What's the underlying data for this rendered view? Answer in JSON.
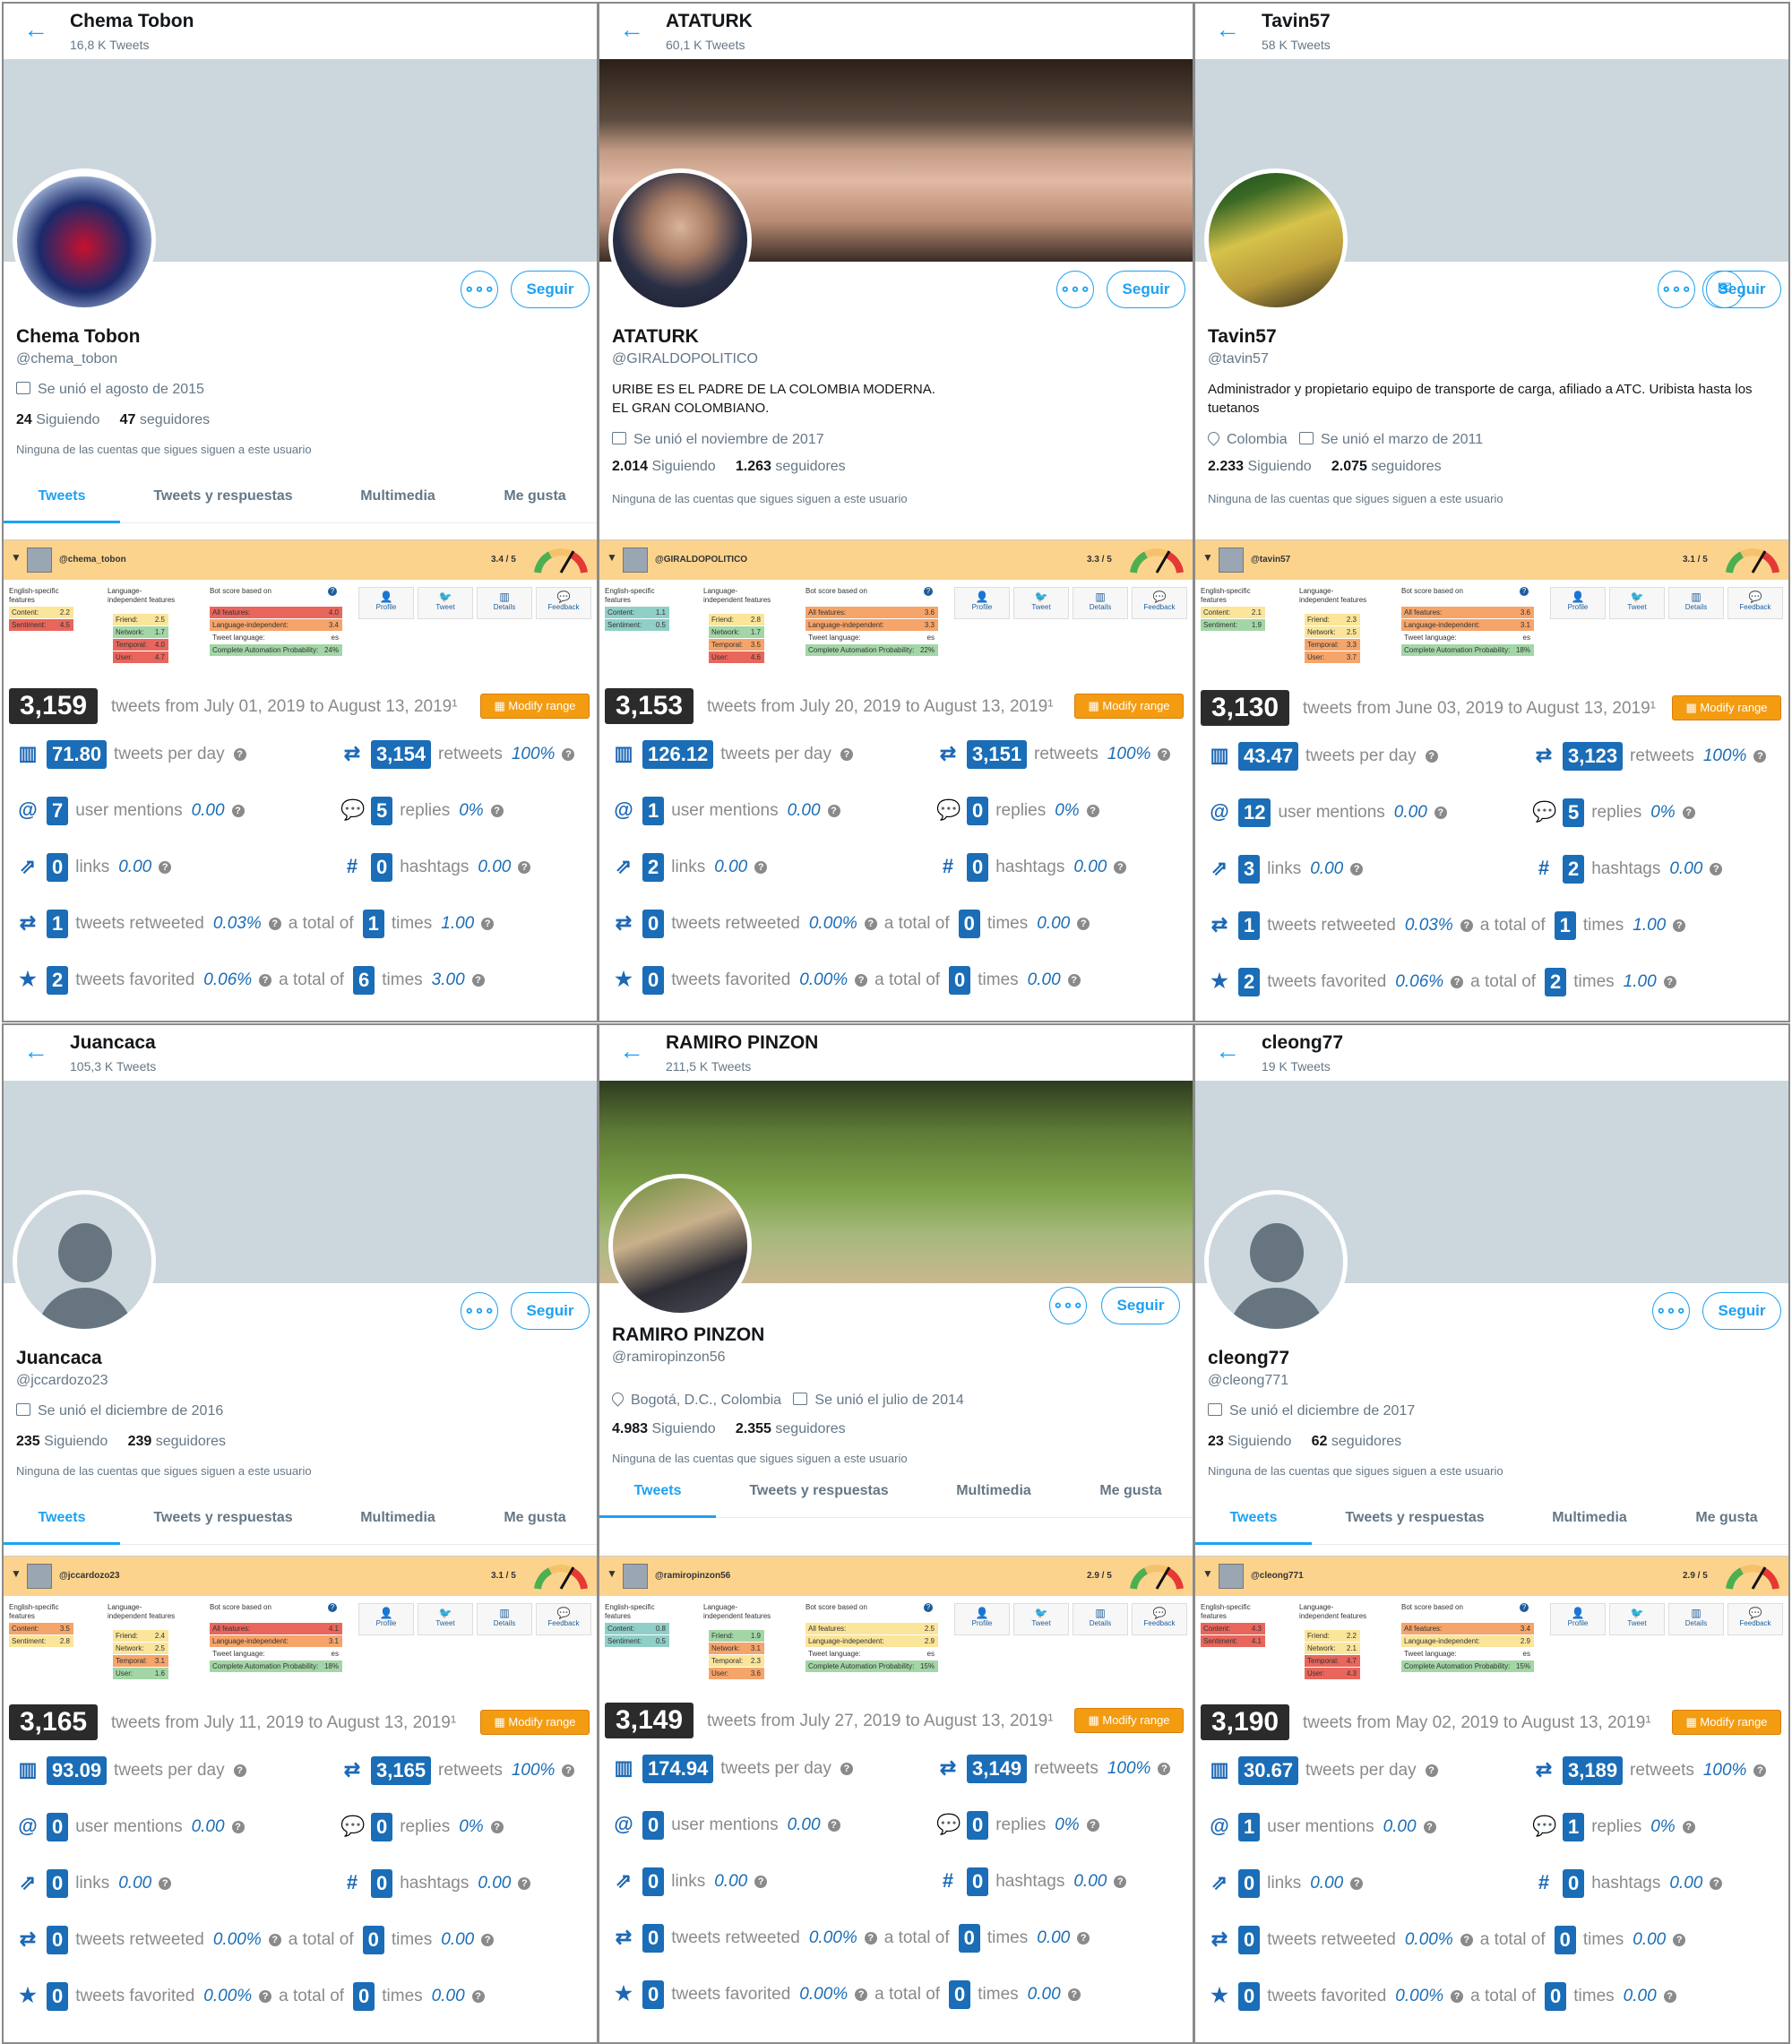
{
  "ui": {
    "back_glyph": "←",
    "more_glyph": "∘∘∘",
    "follow_label": "Seguir",
    "tab_labels": [
      "Tweets",
      "Tweets y respuestas",
      "Multimedia",
      "Me gusta"
    ],
    "modify_label": "Modify range",
    "following_label": "Siguiendo",
    "followers_label": "seguidores",
    "no_follow_text": "Ninguna de las cuentas que sigues siguen a este usuario",
    "lbl_tpd": "tweets per day",
    "lbl_retweets": "retweets",
    "lbl_mentions": "user mentions",
    "lbl_replies": "replies",
    "lbl_links": "links",
    "lbl_hashtags": "hashtags",
    "lbl_rtw": "tweets retweeted",
    "lbl_fav": "tweets favorited",
    "lbl_total": "a total of",
    "lbl_times": "times",
    "b_english": "English-specific features",
    "b_lang": "Language-independent features",
    "b_score": "Bot score based on",
    "b_content": "Content:",
    "b_sentiment": "Sentiment:",
    "b_friend": "Friend:",
    "b_network": "Network:",
    "b_temporal": "Temporal:",
    "b_user": "User:",
    "b_all": "All features:",
    "b_langind": "Language-independent:",
    "b_tl": "Tweet language:",
    "b_cap": "Complete Automation Probability:",
    "b_profile": "Profile",
    "b_tweet": "Tweet",
    "b_details": "Details",
    "b_feedback": "Feedback",
    "icon_names": [
      "chart-icon",
      "retweet-icon",
      "mention-icon",
      "replies-icon",
      "link-icon",
      "hashtag-icon",
      "retweeted-icon",
      "star-icon",
      "calendar-icon",
      "location-icon",
      "mail-icon",
      "back-arrow-icon"
    ]
  },
  "panels": [
    {
      "header_name": "Chema Tobon",
      "header_count": "16,8 K Tweets",
      "name": "Chema Tobon",
      "handle": "@chema_tobon",
      "bio": "",
      "location": "",
      "joined": "Se unió el agosto de 2015",
      "following": "24",
      "followers": "47",
      "bot": {
        "handle": "@chema_tobon",
        "score": "3.4 / 5",
        "content": "2.2",
        "sentiment": "4.5",
        "friend": "2.5",
        "network": "1.7",
        "temporal": "4.0",
        "user": "4.7",
        "all": "4.0",
        "langind": "3.4",
        "tl": "es",
        "cap": "24%"
      },
      "total": "3,159",
      "range": "tweets from July 01, 2019 to August 13, 2019¹",
      "tpd": "71.80",
      "retweets": "3,154",
      "rt_pct": "100%",
      "mentions": "7",
      "mentions_v": "0.00",
      "replies": "5",
      "replies_pct": "0%",
      "links": "0",
      "links_v": "0.00",
      "hashtags": "0",
      "hashtags_v": "0.00",
      "rtw": "1",
      "rtw_pct": "0.03%",
      "rtw_total": "1",
      "rtw_times": "1.00",
      "fav": "2",
      "fav_pct": "0.06%",
      "fav_total": "6",
      "fav_times": "3.00"
    },
    {
      "header_name": "ATATURK",
      "header_count": "60,1 K Tweets",
      "name": "ATATURK",
      "handle": "@GIRALDOPOLITICO",
      "bio": "URIBE ES EL PADRE DE LA COLOMBIA MODERNA.\nEL GRAN COLOMBIANO.",
      "location": "",
      "joined": "Se unió el noviembre de 2017",
      "following": "2.014",
      "followers": "1.263",
      "bot": {
        "handle": "@GIRALDOPOLITICO",
        "score": "3.3 / 5",
        "content": "1.1",
        "sentiment": "0.5",
        "friend": "2.8",
        "network": "1.7",
        "temporal": "3.5",
        "user": "4.6",
        "all": "3.6",
        "langind": "3.3",
        "tl": "es",
        "cap": "22%"
      },
      "total": "3,153",
      "range": "tweets from July 20, 2019 to August 13, 2019¹",
      "tpd": "126.12",
      "retweets": "3,151",
      "rt_pct": "100%",
      "mentions": "1",
      "mentions_v": "0.00",
      "replies": "0",
      "replies_pct": "0%",
      "links": "2",
      "links_v": "0.00",
      "hashtags": "0",
      "hashtags_v": "0.00",
      "rtw": "0",
      "rtw_pct": "0.00%",
      "rtw_total": "0",
      "rtw_times": "0.00",
      "fav": "0",
      "fav_pct": "0.00%",
      "fav_total": "0",
      "fav_times": "0.00"
    },
    {
      "header_name": "Tavin57",
      "header_count": "58 K Tweets",
      "name": "Tavin57",
      "handle": "@tavin57",
      "bio": "Administrador y propietario equipo de transporte de carga, afiliado a ATC. Uribista hasta los tuetanos",
      "location": "Colombia",
      "joined": "Se unió el marzo de 2011",
      "following": "2.233",
      "followers": "2.075",
      "bot": {
        "handle": "@tavin57",
        "score": "3.1 / 5",
        "content": "2.1",
        "sentiment": "1.9",
        "friend": "2.3",
        "network": "2.5",
        "temporal": "3.3",
        "user": "3.7",
        "all": "3.6",
        "langind": "3.1",
        "tl": "es",
        "cap": "18%"
      },
      "total": "3,130",
      "range": "tweets from June 03, 2019 to August 13, 2019¹",
      "tpd": "43.47",
      "retweets": "3,123",
      "rt_pct": "100%",
      "mentions": "12",
      "mentions_v": "0.00",
      "replies": "5",
      "replies_pct": "0%",
      "links": "3",
      "links_v": "0.00",
      "hashtags": "2",
      "hashtags_v": "0.00",
      "rtw": "1",
      "rtw_pct": "0.03%",
      "rtw_total": "1",
      "rtw_times": "1.00",
      "fav": "2",
      "fav_pct": "0.06%",
      "fav_total": "2",
      "fav_times": "1.00"
    },
    {
      "header_name": "Juancaca",
      "header_count": "105,3 K Tweets",
      "name": "Juancaca",
      "handle": "@jccardozo23",
      "bio": "",
      "location": "",
      "joined": "Se unió el diciembre de 2016",
      "following": "235",
      "followers": "239",
      "bot": {
        "handle": "@jccardozo23",
        "score": "3.1 / 5",
        "content": "3.5",
        "sentiment": "2.8",
        "friend": "2.4",
        "network": "2.5",
        "temporal": "3.1",
        "user": "1.6",
        "all": "4.1",
        "langind": "3.1",
        "tl": "es",
        "cap": "18%"
      },
      "total": "3,165",
      "range": "tweets from July 11, 2019 to August 13, 2019¹",
      "tpd": "93.09",
      "retweets": "3,165",
      "rt_pct": "100%",
      "mentions": "0",
      "mentions_v": "0.00",
      "replies": "0",
      "replies_pct": "0%",
      "links": "0",
      "links_v": "0.00",
      "hashtags": "0",
      "hashtags_v": "0.00",
      "rtw": "0",
      "rtw_pct": "0.00%",
      "rtw_total": "0",
      "rtw_times": "0.00",
      "fav": "0",
      "fav_pct": "0.00%",
      "fav_total": "0",
      "fav_times": "0.00"
    },
    {
      "header_name": "RAMIRO PINZON",
      "header_count": "211,5 K Tweets",
      "name": "RAMIRO PINZON",
      "handle": "@ramiropinzon56",
      "bio": "",
      "location": "Bogotá, D.C., Colombia",
      "joined": "Se unió el julio de 2014",
      "following": "4.983",
      "followers": "2.355",
      "bot": {
        "handle": "@ramiropinzon56",
        "score": "2.9 / 5",
        "content": "0.8",
        "sentiment": "0.5",
        "friend": "1.9",
        "network": "3.1",
        "temporal": "2.3",
        "user": "3.6",
        "all": "2.5",
        "langind": "2.9",
        "tl": "es",
        "cap": "15%"
      },
      "total": "3,149",
      "range": "tweets from July 27, 2019 to August 13, 2019¹",
      "tpd": "174.94",
      "retweets": "3,149",
      "rt_pct": "100%",
      "mentions": "0",
      "mentions_v": "0.00",
      "replies": "0",
      "replies_pct": "0%",
      "links": "0",
      "links_v": "0.00",
      "hashtags": "0",
      "hashtags_v": "0.00",
      "rtw": "0",
      "rtw_pct": "0.00%",
      "rtw_total": "0",
      "rtw_times": "0.00",
      "fav": "0",
      "fav_pct": "0.00%",
      "fav_total": "0",
      "fav_times": "0.00"
    },
    {
      "header_name": "cleong77",
      "header_count": "19 K Tweets",
      "name": "cleong77",
      "handle": "@cleong771",
      "bio": "",
      "location": "",
      "joined": "Se unió el diciembre de 2017",
      "following": "23",
      "followers": "62",
      "bot": {
        "handle": "@cleong771",
        "score": "2.9 / 5",
        "content": "4.3",
        "sentiment": "4.1",
        "friend": "2.2",
        "network": "2.1",
        "temporal": "4.7",
        "user": "4.3",
        "all": "3.4",
        "langind": "2.9",
        "tl": "es",
        "cap": "15%"
      },
      "total": "3,190",
      "range": "tweets from May 02, 2019 to August 13, 2019¹",
      "tpd": "30.67",
      "retweets": "3,189",
      "rt_pct": "100%",
      "mentions": "1",
      "mentions_v": "0.00",
      "replies": "1",
      "replies_pct": "0%",
      "links": "0",
      "links_v": "0.00",
      "hashtags": "0",
      "hashtags_v": "0.00",
      "rtw": "0",
      "rtw_pct": "0.00%",
      "rtw_total": "0",
      "rtw_times": "0.00",
      "fav": "0",
      "fav_pct": "0.00%",
      "fav_total": "0",
      "fav_times": "0.00"
    }
  ]
}
